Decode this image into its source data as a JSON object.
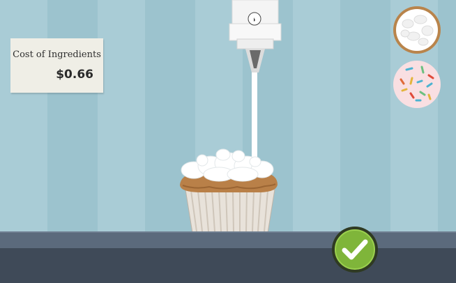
{
  "cost": {
    "label": "Cost of Ingredients",
    "value": "$0.66"
  },
  "dispenser": {
    "icon": "frosting-dispenser-icon"
  },
  "toppings": [
    {
      "name": "coconut-flakes",
      "icon": "coconut-topping-icon"
    },
    {
      "name": "rainbow-sprinkles",
      "icon": "sprinkles-topping-icon"
    }
  ],
  "confirm": {
    "icon": "checkmark-icon",
    "color": "#7fb53a"
  },
  "colors": {
    "wall_light": "#a9ccd6",
    "wall_dark": "#9cc3ce",
    "counter": "#5b6a7c",
    "frosting": "#ffffff",
    "cake": "#b98048"
  }
}
